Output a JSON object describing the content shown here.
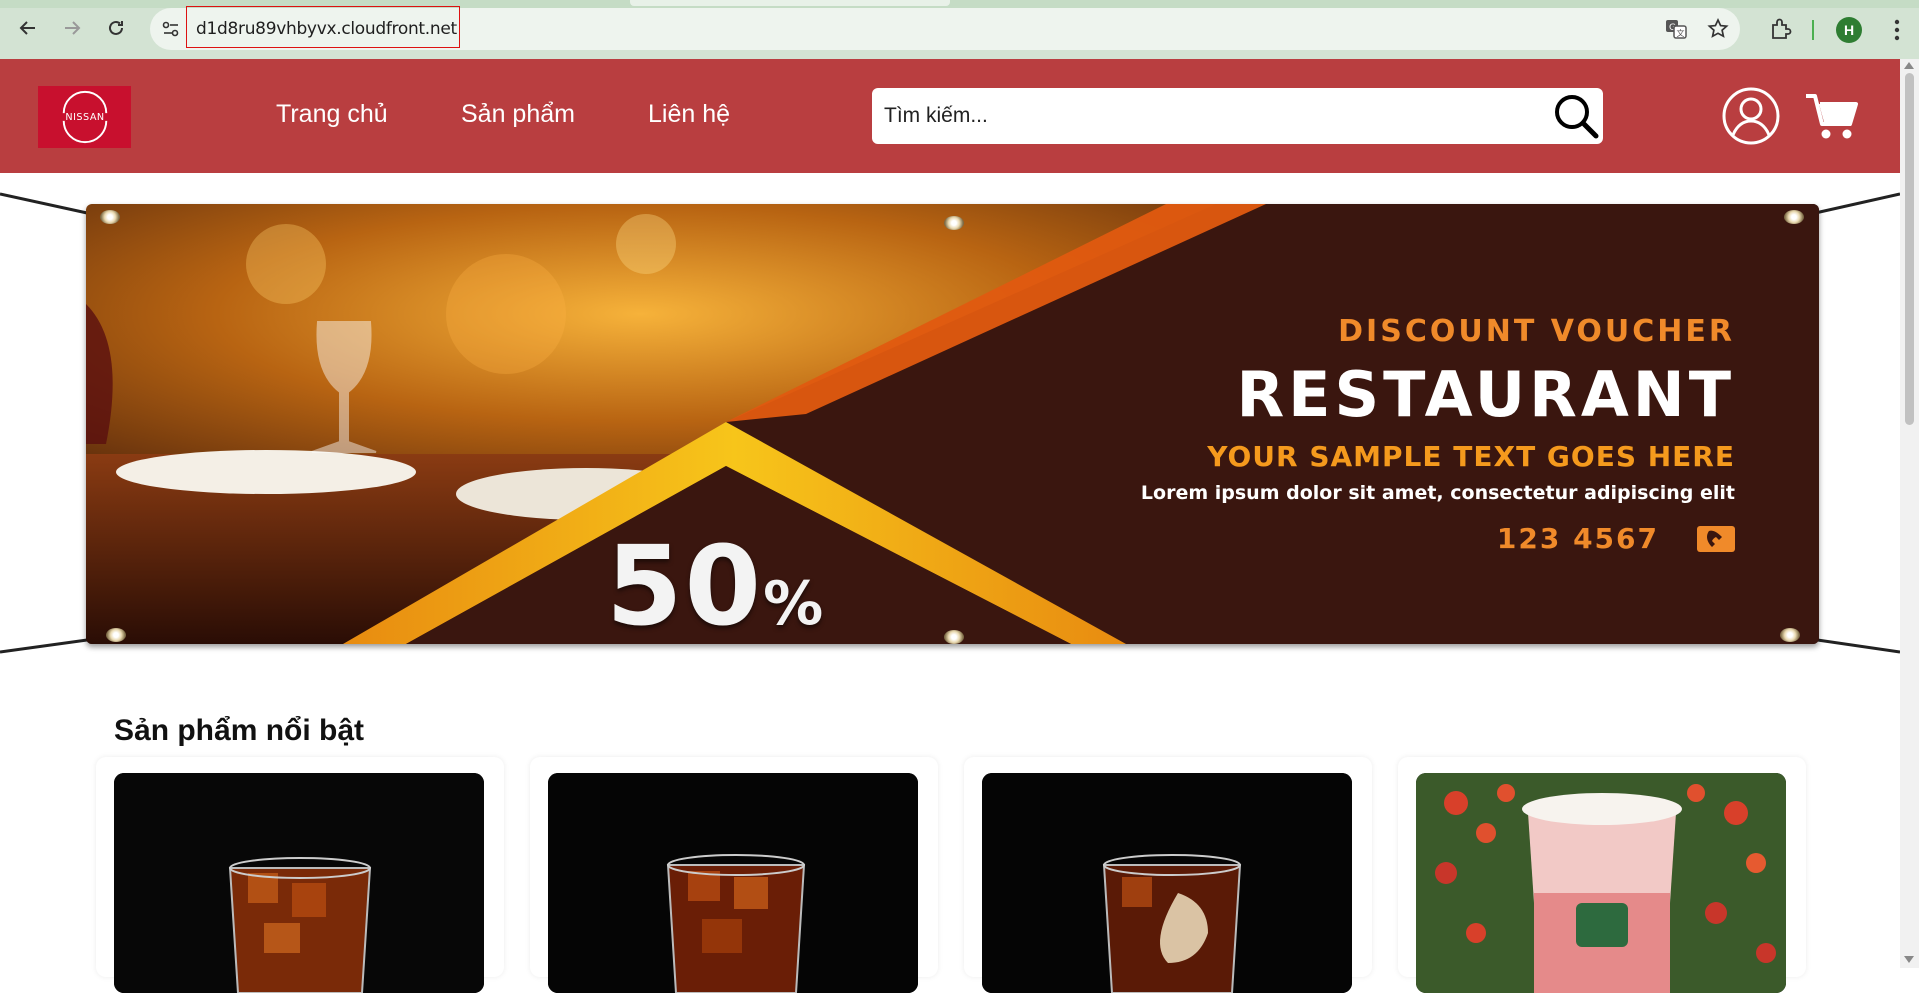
{
  "browser": {
    "url": "d1d8ru89vhbyvx.cloudfront.net",
    "profile_initial": "H"
  },
  "header": {
    "logo_text": "NISSAN",
    "nav": [
      {
        "label": "Trang chủ"
      },
      {
        "label": "Sản phẩm"
      },
      {
        "label": "Liên hệ"
      }
    ],
    "search_placeholder": "Tìm kiếm..."
  },
  "banner": {
    "kicker": "DISCOUNT VOUCHER",
    "title": "RESTAURANT",
    "subtitle": "YOUR SAMPLE TEXT GOES HERE",
    "body": "Lorem ipsum dolor sit amet, consectetur adipiscing elit",
    "phone": "123 4567",
    "discount_number": "50",
    "discount_symbol": "%"
  },
  "featured": {
    "title": "Sản phẩm nổi bật",
    "products": [
      {
        "image": "iced-tea-glass"
      },
      {
        "image": "iced-tea-glass"
      },
      {
        "image": "iced-coffee-glass"
      },
      {
        "image": "fruit-tea-cup"
      }
    ]
  },
  "colors": {
    "header_bg": "#b93e40",
    "logo_bg": "#c8102e",
    "banner_accent": "#f08a2a",
    "banner_dark": "#3a160f"
  }
}
